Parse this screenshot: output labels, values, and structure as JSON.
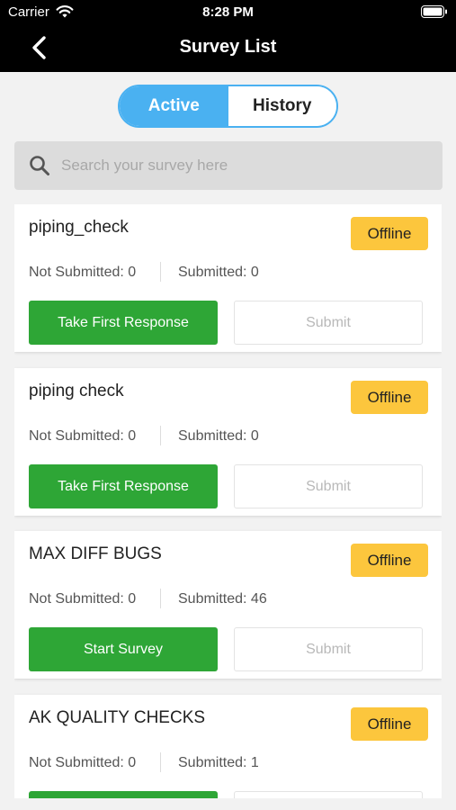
{
  "status_bar": {
    "carrier": "Carrier",
    "time": "8:28 PM",
    "wifi_icon": "wifi-icon",
    "battery_icon": "battery-icon"
  },
  "nav": {
    "title": "Survey List",
    "back_icon": "chevron-left-icon"
  },
  "tabs": [
    {
      "label": "Active",
      "selected": true
    },
    {
      "label": "History",
      "selected": false
    }
  ],
  "search": {
    "placeholder": "Search your survey here",
    "value": "",
    "icon": "search-icon"
  },
  "colors": {
    "accent": "#4ab1f1",
    "primary_button": "#2ea636",
    "offline_badge": "#fcc63d",
    "header": "#000000"
  },
  "surveys": [
    {
      "name": "piping_check",
      "status": "Offline",
      "not_submitted": "Not Submitted: 0",
      "submitted": "Submitted: 0",
      "primary_action": "Take First Response",
      "secondary_action": "Submit"
    },
    {
      "name": "piping check",
      "status": "Offline",
      "not_submitted": "Not Submitted: 0",
      "submitted": "Submitted: 0",
      "primary_action": "Take First Response",
      "secondary_action": "Submit"
    },
    {
      "name": "MAX DIFF BUGS",
      "status": "Offline",
      "not_submitted": "Not Submitted: 0",
      "submitted": "Submitted: 46",
      "primary_action": "Start Survey",
      "secondary_action": "Submit"
    },
    {
      "name": "AK QUALITY CHECKS",
      "status": "Offline",
      "not_submitted": "Not Submitted: 0",
      "submitted": "Submitted: 1",
      "primary_action": "",
      "secondary_action": ""
    }
  ]
}
